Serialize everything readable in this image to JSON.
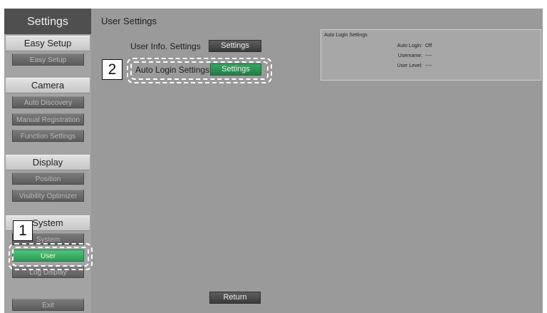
{
  "sidebar": {
    "title": "Settings",
    "sections": [
      {
        "header": "Easy Setup",
        "items": [
          "Easy Setup"
        ]
      },
      {
        "header": "Camera",
        "items": [
          "Auto Discovery",
          "Manual Registration",
          "Function Settings"
        ]
      },
      {
        "header": "Display",
        "items": [
          "Position",
          "Visibility Optimizer"
        ]
      },
      {
        "header": "System",
        "items": [
          "System",
          "User",
          "Log Display"
        ]
      }
    ],
    "selected_item": "User",
    "exit_label": "Exit"
  },
  "main": {
    "title": "User Settings",
    "user_info_label": "User Info. Settings",
    "user_info_button": "Settings",
    "auto_login_label": "Auto Login Settings",
    "auto_login_button": "Settings",
    "return_label": "Return"
  },
  "info_panel": {
    "title": "Auto Login Settings",
    "rows": [
      {
        "key": "Auto Login:",
        "value": "Off"
      },
      {
        "key": "Username:",
        "value": "----"
      },
      {
        "key": "User Level:",
        "value": "----"
      }
    ]
  },
  "callouts": {
    "one": "1",
    "two": "2"
  },
  "colors": {
    "selected_green": "#2fa35b",
    "sidebar_title_bg": "#4f4f4f"
  }
}
